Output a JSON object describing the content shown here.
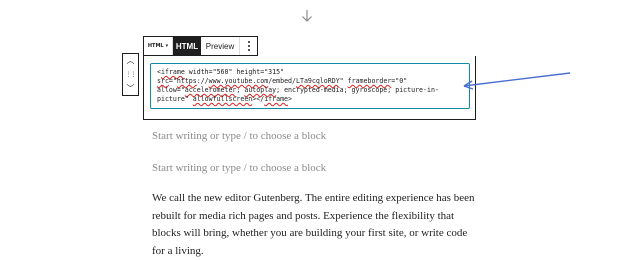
{
  "icons": {
    "down_arrow": "arrow-down-icon",
    "mover_up": "chevron-up-icon",
    "mover_drag": "drag-handle-icon",
    "mover_down": "chevron-down-icon",
    "more_options": "vertical-ellipsis-icon"
  },
  "toolbar": {
    "block_type_label": "HTML",
    "block_type_caret": "▾",
    "tab_html": "HTML",
    "tab_preview": "Preview",
    "active_tab": "HTML"
  },
  "html_block": {
    "code_parts": [
      [
        "<",
        false
      ],
      [
        "iframe",
        true
      ],
      [
        " width=\"560\" height=\"315\"\n",
        false
      ],
      [
        "src",
        true
      ],
      [
        "=\"",
        false
      ],
      [
        "https",
        true
      ],
      [
        "://",
        false
      ],
      [
        "www.youtube.com",
        true
      ],
      [
        "/embed/",
        false
      ],
      [
        "LTa9cqloRDY",
        true
      ],
      [
        "\" ",
        false
      ],
      [
        "frameborder",
        true
      ],
      [
        "=\"0\"\n",
        false
      ],
      [
        "allow=\"",
        false
      ],
      [
        "accelerometer",
        true
      ],
      [
        "; ",
        false
      ],
      [
        "autoplay",
        true
      ],
      [
        "; encrypted-media; gyroscope; picture-in-\npicture\" ",
        false
      ],
      [
        "allowfullscreen",
        true
      ],
      [
        "></",
        false
      ],
      [
        "iframe",
        true
      ],
      [
        ">",
        false
      ]
    ]
  },
  "colors": {
    "focus_border": "#0f8ba6",
    "annotation_arrow": "#4a6fd1",
    "placeholder_text": "#8a8a8a"
  },
  "placeholders": [
    "Start writing or type / to choose a block",
    "Start writing or type / to choose a block"
  ],
  "paragraph": "We call the new editor Gutenberg. The entire editing experience has been rebuilt for media rich pages and posts. Experience the flexibility that blocks will bring, whether you are building your first site, or write code for a living."
}
